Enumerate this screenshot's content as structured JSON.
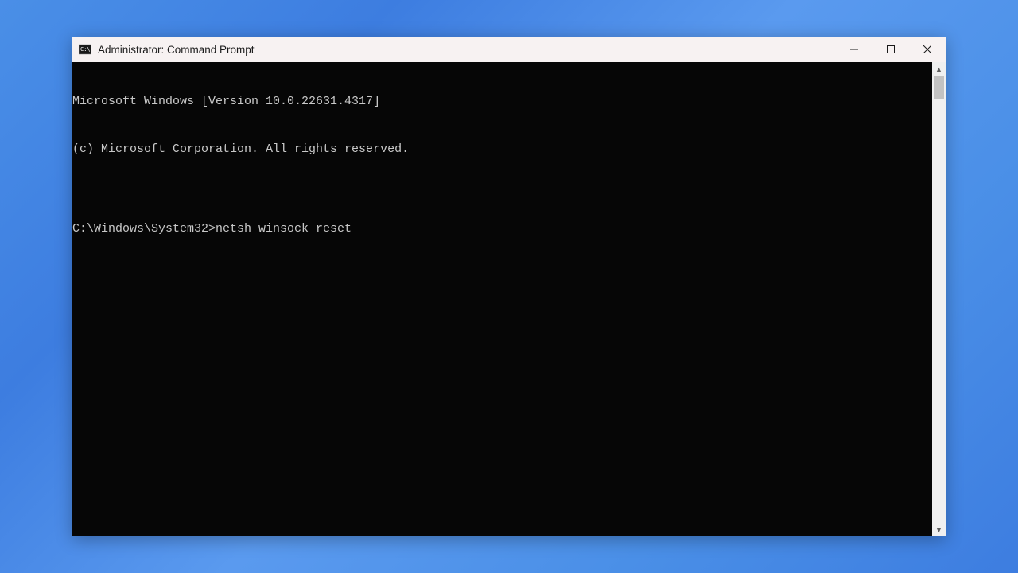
{
  "window": {
    "title": "Administrator: Command Prompt"
  },
  "terminal": {
    "lines": [
      "Microsoft Windows [Version 10.0.22631.4317]",
      "(c) Microsoft Corporation. All rights reserved.",
      "",
      "C:\\Windows\\System32>netsh winsock reset"
    ]
  }
}
